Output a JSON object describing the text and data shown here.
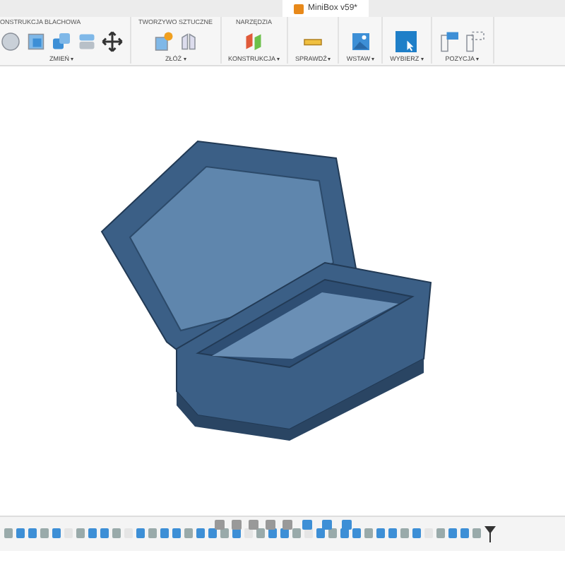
{
  "window": {
    "title": "MiniBox v59*"
  },
  "ribbon": [
    {
      "group_label": "ONSTRUKCJA BLACHOWA",
      "menu": "ZMIEŃ"
    },
    {
      "group_label": "TWORZYWO SZTUCZNE",
      "menu": "ZŁÓŻ"
    },
    {
      "group_label": "NARZĘDZIA",
      "menu": "KONSTRUKCJA"
    },
    {
      "menu": "SPRAWDŹ"
    },
    {
      "menu": "WSTAW"
    },
    {
      "menu": "WYBIERZ"
    },
    {
      "menu": "POZYCJA"
    }
  ]
}
